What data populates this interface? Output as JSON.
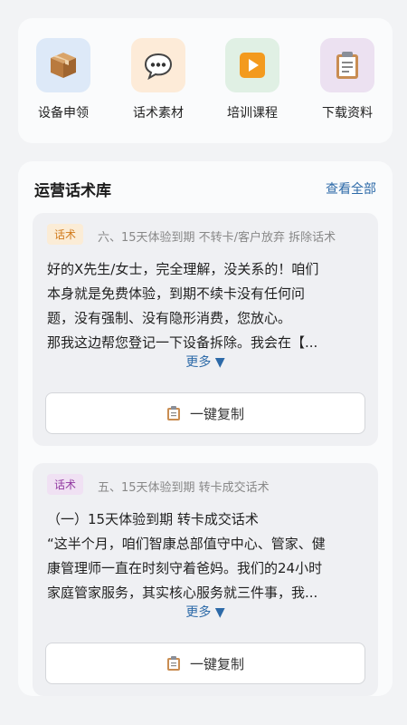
{
  "quick_actions": [
    {
      "label": "设备申领",
      "icon": "package-icon",
      "bg": "#dde9f8"
    },
    {
      "label": "话术素材",
      "icon": "speech-bubble-icon",
      "bg": "#fdebd8"
    },
    {
      "label": "培训课程",
      "icon": "play-icon",
      "bg": "#e0f0e4"
    },
    {
      "label": "下载资料",
      "icon": "clipboard-icon",
      "bg": "#ece1f1"
    }
  ],
  "scripts_section": {
    "title": "运营话术库",
    "view_all": "查看全部",
    "items": [
      {
        "tag": "话术",
        "tag_color": "#d17a1b",
        "meta": "六、15天体验到期 不转卡/客户放弃 拆除话术",
        "content": "好的X先生/女士，完全理解，没关系的！咱们\n本身就是免费体验，到期不续卡没有任何问\n题，没有强制、没有隐形消费，您放心。\n那我这边帮您登记一下设备拆除。我会在【...",
        "more": "更多 ▼",
        "copy_label": "一键复制"
      },
      {
        "tag": "话术",
        "tag_color": "#9138a0",
        "meta": "五、15天体验到期 转卡成交话术",
        "content": "（一）15天体验到期 转卡成交话术\n“这半个月，咱们智康总部值守中心、管家、健\n康管理师一直在时刻守着爸妈。我们的24小时\n家庭管家服务，其实核心服务就三件事，我...",
        "more": "更多 ▼",
        "copy_label": "一键复制"
      }
    ]
  }
}
